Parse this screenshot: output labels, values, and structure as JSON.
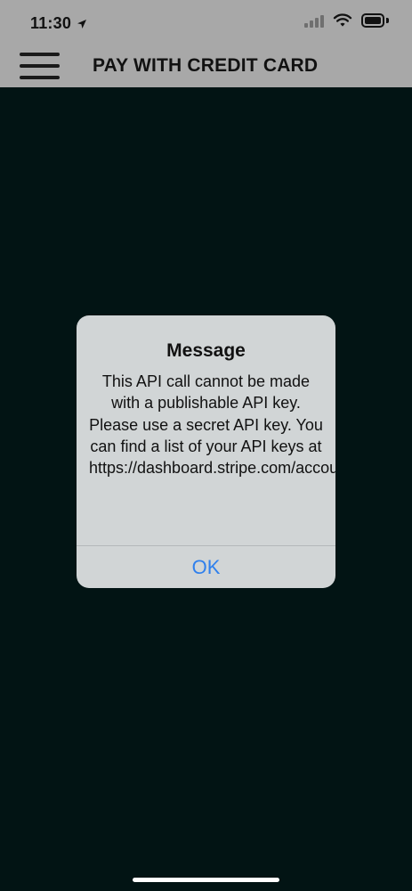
{
  "status_bar": {
    "time": "11:30"
  },
  "header": {
    "title": "PAY WITH CREDIT CARD"
  },
  "dialog": {
    "title": "Message",
    "message": "This API call cannot be made with a publishable API key. Please use a secret API key. You can find a list of your API keys at https://dashboard.stripe.com/account/apikeys.",
    "ok_label": "OK"
  },
  "colors": {
    "header_bg": "#a8a8a8",
    "screen_bg": "#021414",
    "dialog_bg": "#d1d5d6",
    "action_blue": "#2f80ed"
  },
  "icons": {
    "location": "location-arrow-icon",
    "signal": "cellular-signal-icon",
    "wifi": "wifi-icon",
    "battery": "battery-icon",
    "menu": "hamburger-menu-icon"
  }
}
